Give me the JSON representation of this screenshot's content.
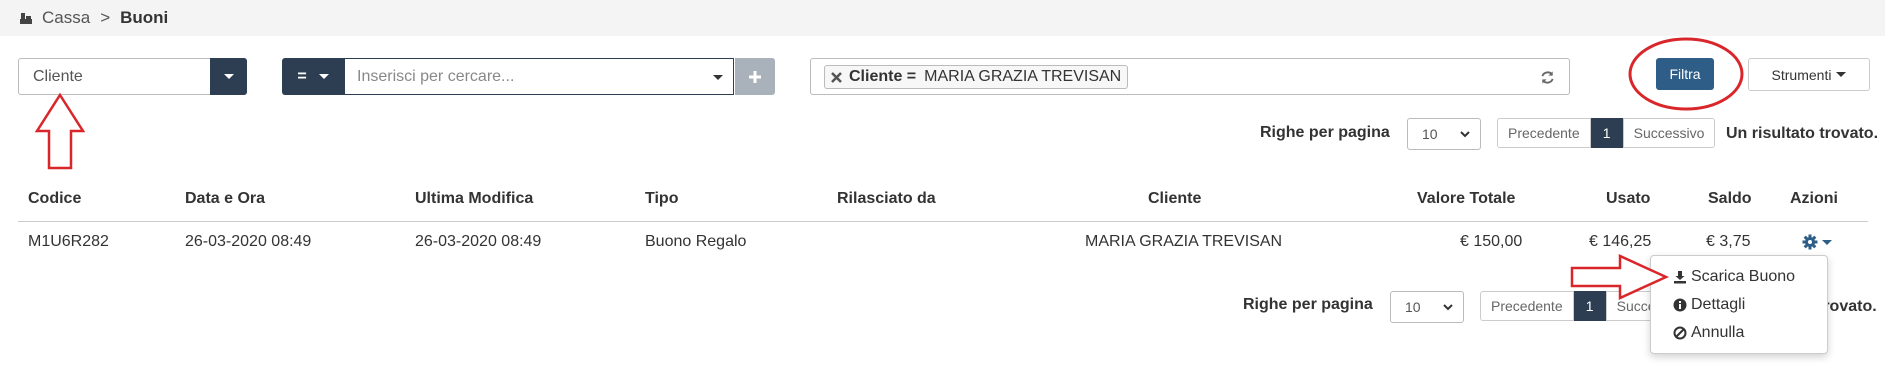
{
  "breadcrumb": {
    "root": "Cassa",
    "separator": ">",
    "current": "Buoni"
  },
  "filters": {
    "field_select": "Cliente",
    "operator": "=",
    "search_placeholder": "Inserisci per cercare...",
    "active_chip": {
      "label": "Cliente =",
      "value": "MARIA GRAZIA TREVISAN"
    },
    "filter_button": "Filtra",
    "tools_button": "Strumenti"
  },
  "pagination_top": {
    "rows_label": "Righe per pagina",
    "rows_value": "10",
    "prev": "Precedente",
    "page": "1",
    "next": "Successivo",
    "result_text": "Un risultato trovato."
  },
  "pagination_bottom": {
    "rows_label": "Righe per pagina",
    "rows_value": "10",
    "prev": "Precedente",
    "page": "1",
    "next": "Succe",
    "result_text": "trovato."
  },
  "table": {
    "headers": {
      "codice": "Codice",
      "data": "Data e Ora",
      "modifica": "Ultima Modifica",
      "tipo": "Tipo",
      "rilasciato": "Rilasciato da",
      "cliente": "Cliente",
      "valore": "Valore Totale",
      "usato": "Usato",
      "saldo": "Saldo",
      "azioni": "Azioni"
    },
    "rows": [
      {
        "codice": "M1U6R282",
        "data": "26-03-2020 08:49",
        "modifica": "26-03-2020 08:49",
        "tipo": "Buono Regalo",
        "rilasciato": "",
        "cliente": "MARIA GRAZIA TREVISAN",
        "valore": "€ 150,00",
        "usato": "€ 146,25",
        "saldo": "€ 3,75"
      }
    ]
  },
  "actions_menu": {
    "items": [
      "Scarica Buono",
      "Dettagli",
      "Annulla"
    ]
  },
  "colors": {
    "primary": "#2e3e52",
    "accent": "#2e5d87",
    "annotation": "#d9262b"
  }
}
